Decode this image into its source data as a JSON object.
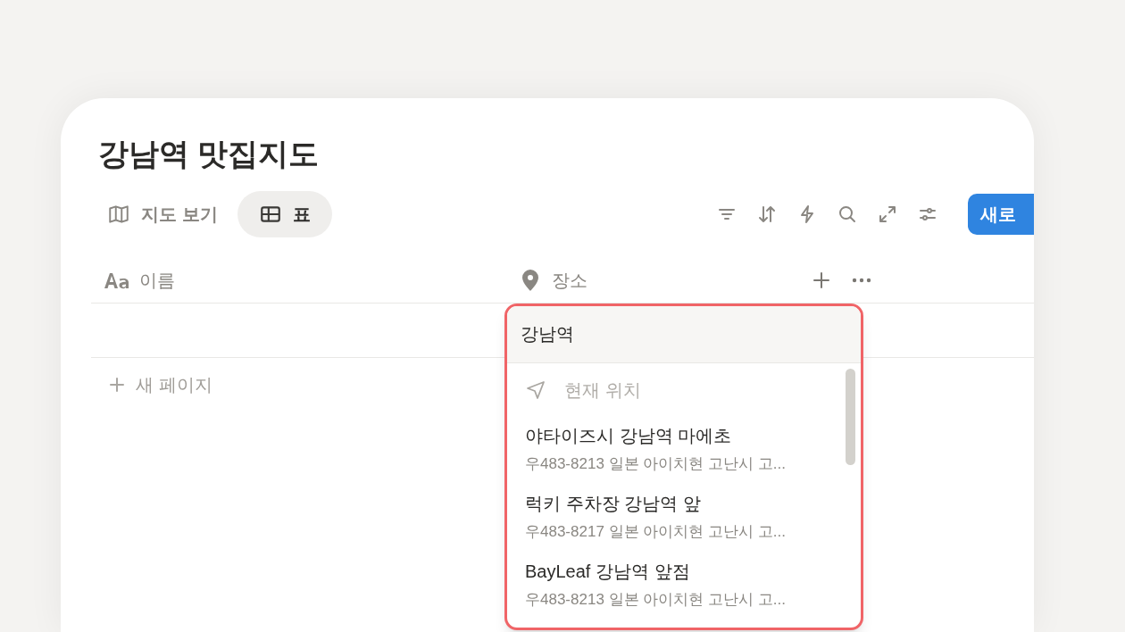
{
  "title": "강남역 맛집지도",
  "views": [
    {
      "label": "지도 보기",
      "kind": "map",
      "selected": false
    },
    {
      "label": "표",
      "kind": "table",
      "selected": true
    }
  ],
  "new_button": "새로",
  "columns": [
    {
      "label": "이름",
      "kind": "text"
    },
    {
      "label": "장소",
      "kind": "place"
    }
  ],
  "add_row": "새 페이지",
  "place_search": {
    "value": "강남역",
    "current_location": "현재 위치",
    "results": [
      {
        "name": "야타이즈시 강남역 마에초",
        "address": "우483-8213 일본 아이치현 고난시 고..."
      },
      {
        "name": "럭키 주차장 강남역 앞",
        "address": "우483-8217 일본 아이치현 고난시 고..."
      },
      {
        "name": "BayLeaf 강남역 앞점",
        "address": "우483-8213 일본 아이치현 고난시 고..."
      }
    ]
  }
}
